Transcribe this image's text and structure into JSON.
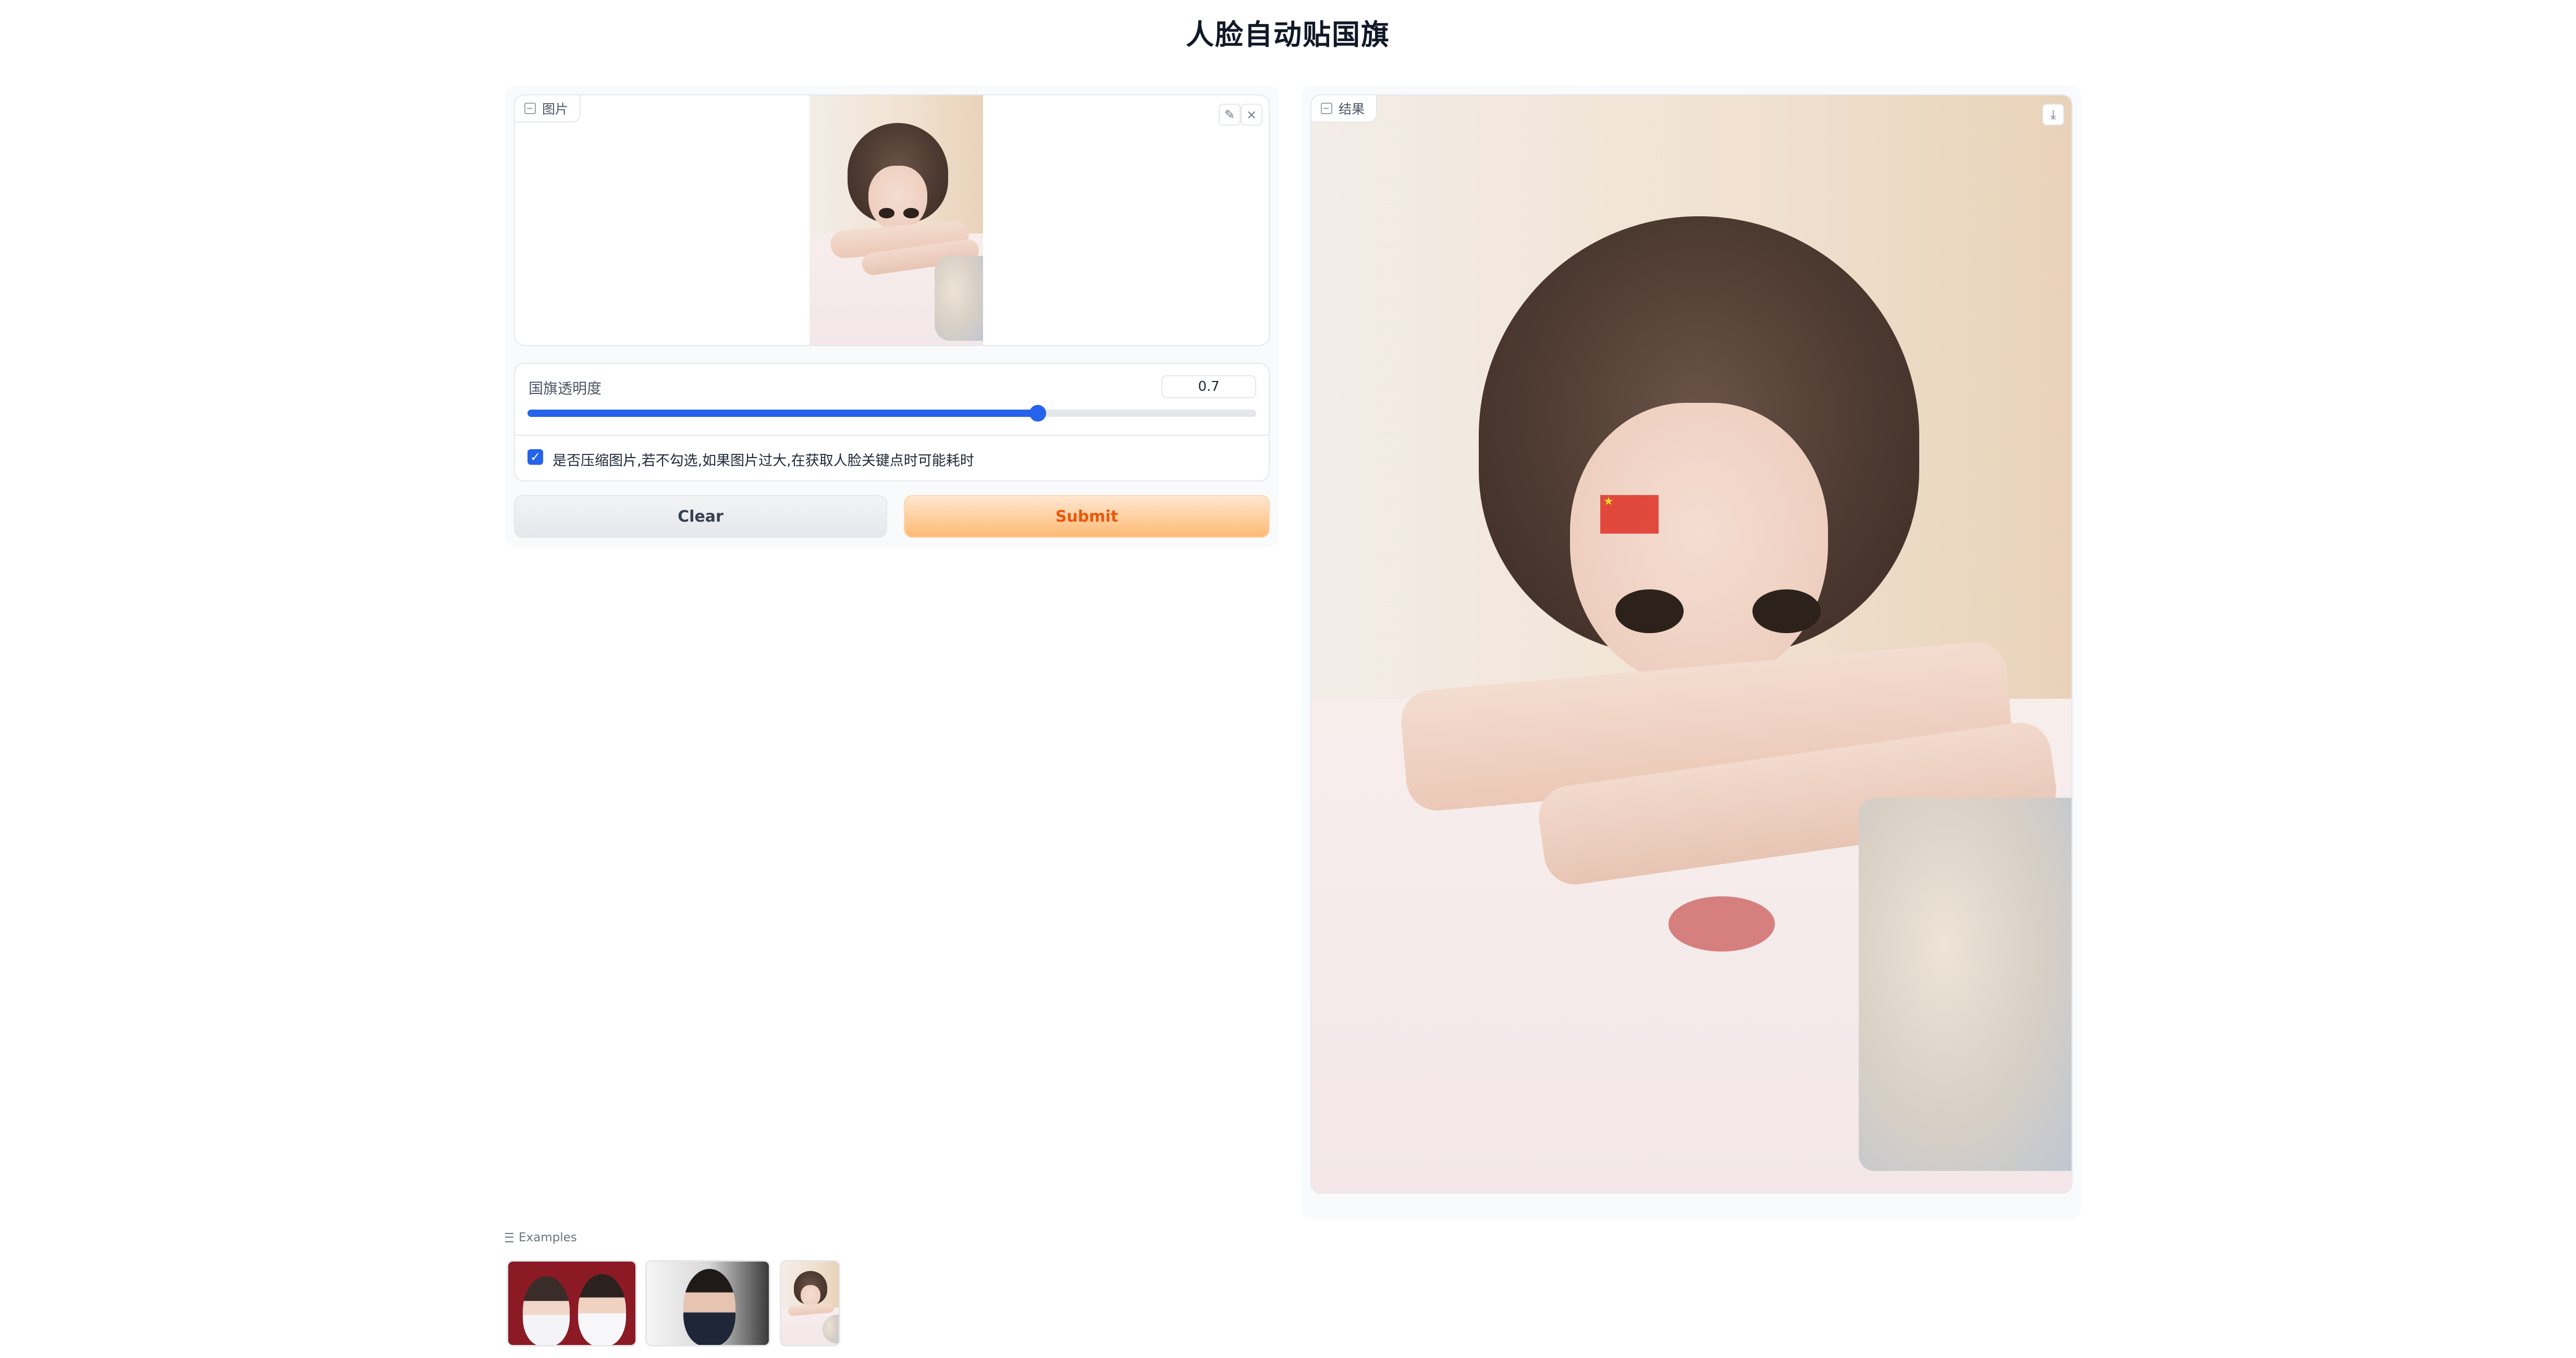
{
  "page": {
    "title": "人脸自动贴国旗"
  },
  "input_image": {
    "label": "图片",
    "edit_icon": "pencil-icon",
    "clear_icon": "close-icon"
  },
  "opacity": {
    "label": "国旗透明度",
    "value": "0.7",
    "fraction": 0.7
  },
  "compress": {
    "checked": true,
    "label": "是否压缩图片,若不勾选,如果图片过大,在获取人脸关键点时可能耗时"
  },
  "buttons": {
    "clear": "Clear",
    "submit": "Submit"
  },
  "result": {
    "label": "结果",
    "download_icon": "download-icon"
  },
  "examples": {
    "label": "Examples"
  },
  "colors": {
    "accent": "#2563eb",
    "submit_text": "#ea580c",
    "flag_red": "#de2a1f"
  }
}
